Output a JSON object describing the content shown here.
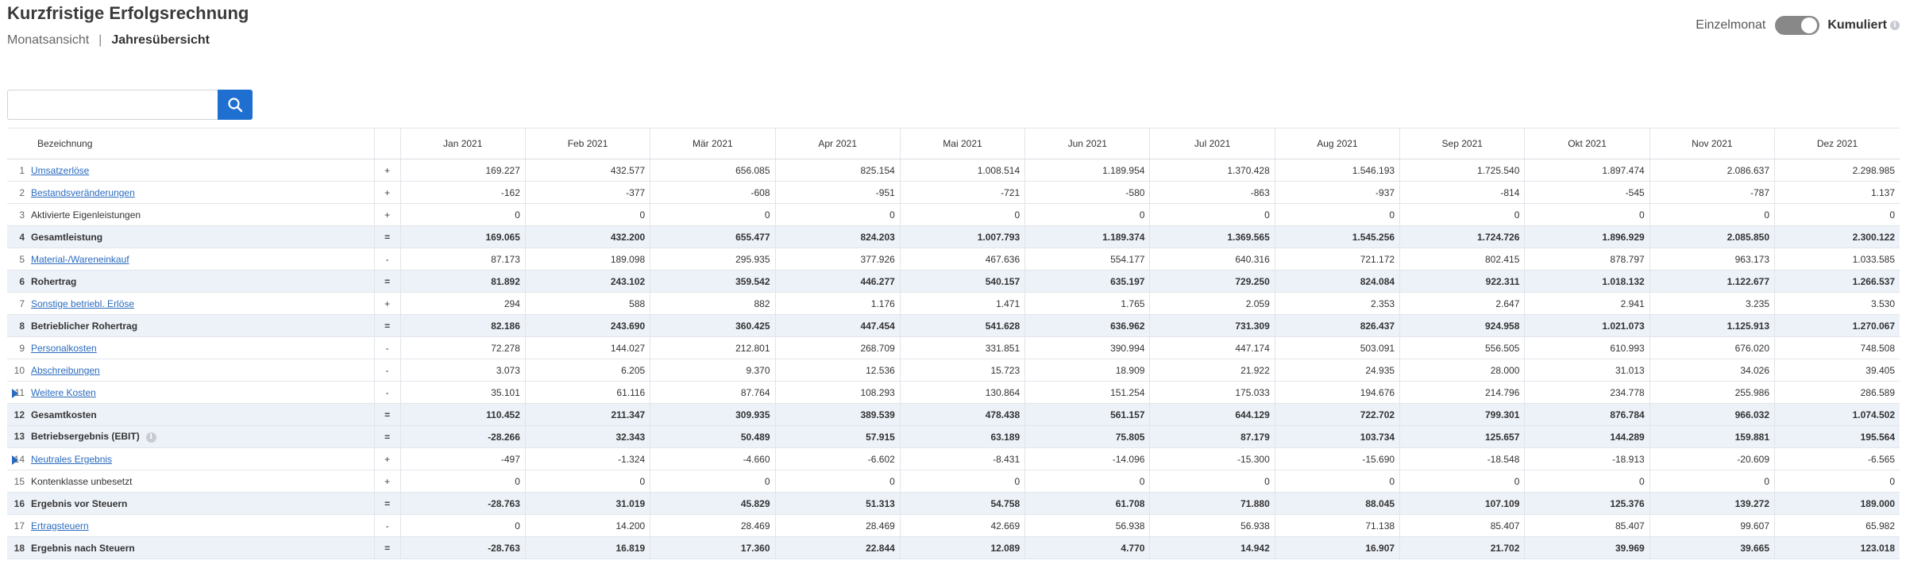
{
  "page": {
    "title": "Kurzfristige Erfolgsrechnung"
  },
  "view_nav": {
    "monthly": "Monatsansicht",
    "separator": "|",
    "yearly": "Jahresübersicht"
  },
  "toggle": {
    "left_label": "Einzelmonat",
    "right_label": "Kumuliert",
    "state": "Kumuliert",
    "info_icon": "info-icon"
  },
  "search": {
    "value": "",
    "placeholder": "",
    "button_icon": "search-icon"
  },
  "table": {
    "name_header": "Bezeichnung",
    "months": [
      "Jan 2021",
      "Feb 2021",
      "Mär 2021",
      "Apr 2021",
      "Mai 2021",
      "Jun 2021",
      "Jul 2021",
      "Aug 2021",
      "Sep 2021",
      "Okt 2021",
      "Nov 2021",
      "Dez 2021"
    ],
    "rows": [
      {
        "num": "1",
        "label": "Umsatzerlöse",
        "link": true,
        "op": "+",
        "subtotal": false,
        "expand": false,
        "values": [
          "169.227",
          "432.577",
          "656.085",
          "825.154",
          "1.008.514",
          "1.189.954",
          "1.370.428",
          "1.546.193",
          "1.725.540",
          "1.897.474",
          "2.086.637",
          "2.298.985"
        ]
      },
      {
        "num": "2",
        "label": "Bestandsveränderungen",
        "link": true,
        "op": "+",
        "subtotal": false,
        "expand": false,
        "values": [
          "-162",
          "-377",
          "-608",
          "-951",
          "-721",
          "-580",
          "-863",
          "-937",
          "-814",
          "-545",
          "-787",
          "1.137"
        ]
      },
      {
        "num": "3",
        "label": "Aktivierte Eigenleistungen",
        "link": false,
        "op": "+",
        "subtotal": false,
        "expand": false,
        "values": [
          "0",
          "0",
          "0",
          "0",
          "0",
          "0",
          "0",
          "0",
          "0",
          "0",
          "0",
          "0"
        ]
      },
      {
        "num": "4",
        "label": "Gesamtleistung",
        "link": false,
        "op": "=",
        "subtotal": true,
        "expand": false,
        "values": [
          "169.065",
          "432.200",
          "655.477",
          "824.203",
          "1.007.793",
          "1.189.374",
          "1.369.565",
          "1.545.256",
          "1.724.726",
          "1.896.929",
          "2.085.850",
          "2.300.122"
        ]
      },
      {
        "num": "5",
        "label": "Material-/Wareneinkauf",
        "link": true,
        "op": "-",
        "subtotal": false,
        "expand": false,
        "values": [
          "87.173",
          "189.098",
          "295.935",
          "377.926",
          "467.636",
          "554.177",
          "640.316",
          "721.172",
          "802.415",
          "878.797",
          "963.173",
          "1.033.585"
        ]
      },
      {
        "num": "6",
        "label": "Rohertrag",
        "link": false,
        "op": "=",
        "subtotal": true,
        "expand": false,
        "values": [
          "81.892",
          "243.102",
          "359.542",
          "446.277",
          "540.157",
          "635.197",
          "729.250",
          "824.084",
          "922.311",
          "1.018.132",
          "1.122.677",
          "1.266.537"
        ]
      },
      {
        "num": "7",
        "label": "Sonstige betriebl. Erlöse",
        "link": true,
        "op": "+",
        "subtotal": false,
        "expand": false,
        "values": [
          "294",
          "588",
          "882",
          "1.176",
          "1.471",
          "1.765",
          "2.059",
          "2.353",
          "2.647",
          "2.941",
          "3.235",
          "3.530"
        ]
      },
      {
        "num": "8",
        "label": "Betrieblicher Rohertrag",
        "link": false,
        "op": "=",
        "subtotal": true,
        "expand": false,
        "values": [
          "82.186",
          "243.690",
          "360.425",
          "447.454",
          "541.628",
          "636.962",
          "731.309",
          "826.437",
          "924.958",
          "1.021.073",
          "1.125.913",
          "1.270.067"
        ]
      },
      {
        "num": "9",
        "label": "Personalkosten",
        "link": true,
        "op": "-",
        "subtotal": false,
        "expand": false,
        "values": [
          "72.278",
          "144.027",
          "212.801",
          "268.709",
          "331.851",
          "390.994",
          "447.174",
          "503.091",
          "556.505",
          "610.993",
          "676.020",
          "748.508"
        ]
      },
      {
        "num": "10",
        "label": "Abschreibungen",
        "link": true,
        "op": "-",
        "subtotal": false,
        "expand": false,
        "values": [
          "3.073",
          "6.205",
          "9.370",
          "12.536",
          "15.723",
          "18.909",
          "21.922",
          "24.935",
          "28.000",
          "31.013",
          "34.026",
          "39.405"
        ]
      },
      {
        "num": "11",
        "label": "Weitere Kosten",
        "link": true,
        "op": "-",
        "subtotal": false,
        "expand": true,
        "values": [
          "35.101",
          "61.116",
          "87.764",
          "108.293",
          "130.864",
          "151.254",
          "175.033",
          "194.676",
          "214.796",
          "234.778",
          "255.986",
          "286.589"
        ]
      },
      {
        "num": "12",
        "label": "Gesamtkosten",
        "link": false,
        "op": "=",
        "subtotal": true,
        "expand": false,
        "values": [
          "110.452",
          "211.347",
          "309.935",
          "389.539",
          "478.438",
          "561.157",
          "644.129",
          "722.702",
          "799.301",
          "876.784",
          "966.032",
          "1.074.502"
        ]
      },
      {
        "num": "13",
        "label": "Betriebsergebnis (EBIT)",
        "link": false,
        "op": "=",
        "subtotal": true,
        "expand": false,
        "info": true,
        "values": [
          "-28.266",
          "32.343",
          "50.489",
          "57.915",
          "63.189",
          "75.805",
          "87.179",
          "103.734",
          "125.657",
          "144.289",
          "159.881",
          "195.564"
        ]
      },
      {
        "num": "14",
        "label": "Neutrales Ergebnis",
        "link": true,
        "op": "+",
        "subtotal": false,
        "expand": true,
        "values": [
          "-497",
          "-1.324",
          "-4.660",
          "-6.602",
          "-8.431",
          "-14.096",
          "-15.300",
          "-15.690",
          "-18.548",
          "-18.913",
          "-20.609",
          "-6.565"
        ]
      },
      {
        "num": "15",
        "label": "Kontenklasse unbesetzt",
        "link": false,
        "op": "+",
        "subtotal": false,
        "expand": false,
        "values": [
          "0",
          "0",
          "0",
          "0",
          "0",
          "0",
          "0",
          "0",
          "0",
          "0",
          "0",
          "0"
        ]
      },
      {
        "num": "16",
        "label": "Ergebnis vor Steuern",
        "link": false,
        "op": "=",
        "subtotal": true,
        "expand": false,
        "values": [
          "-28.763",
          "31.019",
          "45.829",
          "51.313",
          "54.758",
          "61.708",
          "71.880",
          "88.045",
          "107.109",
          "125.376",
          "139.272",
          "189.000"
        ]
      },
      {
        "num": "17",
        "label": "Ertragsteuern",
        "link": true,
        "op": "-",
        "subtotal": false,
        "expand": false,
        "values": [
          "0",
          "14.200",
          "28.469",
          "28.469",
          "42.669",
          "56.938",
          "56.938",
          "71.138",
          "85.407",
          "85.407",
          "99.607",
          "65.982"
        ]
      },
      {
        "num": "18",
        "label": "Ergebnis nach Steuern",
        "link": false,
        "op": "=",
        "subtotal": true,
        "expand": false,
        "values": [
          "-28.763",
          "16.819",
          "17.360",
          "22.844",
          "12.089",
          "4.770",
          "14.942",
          "16.907",
          "21.702",
          "39.969",
          "39.665",
          "123.018"
        ]
      }
    ]
  }
}
